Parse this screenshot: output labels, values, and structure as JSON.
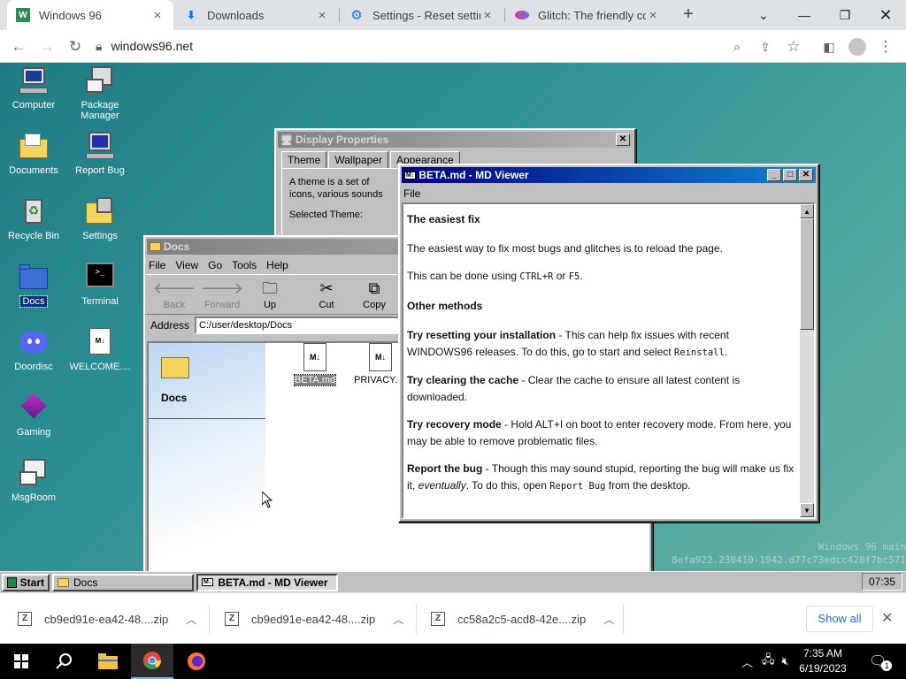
{
  "browser": {
    "tabs": [
      {
        "title": "Windows 96",
        "active": true
      },
      {
        "title": "Downloads",
        "active": false
      },
      {
        "title": "Settings - Reset settings",
        "active": false
      },
      {
        "title": "Glitch: The friendly community",
        "active": false
      }
    ],
    "new_tab": "+",
    "url": "windows96.net"
  },
  "desktop": {
    "icons": [
      {
        "label": "Computer",
        "icon": "computer-icon"
      },
      {
        "label": "Package Manager",
        "icon": "package-icon"
      },
      {
        "label": "Documents",
        "icon": "folder-icon"
      },
      {
        "label": "Report Bug",
        "icon": "bug-report-icon"
      },
      {
        "label": "Recycle Bin",
        "icon": "recycle-bin-icon"
      },
      {
        "label": "Settings",
        "icon": "settings-icon"
      },
      {
        "label": "Docs",
        "icon": "folder-icon",
        "selected": true
      },
      {
        "label": "Terminal",
        "icon": "terminal-icon"
      },
      {
        "label": "Doordisc",
        "icon": "discord-icon"
      },
      {
        "label": "WELCOME....",
        "icon": "md-file-icon"
      },
      {
        "label": "Gaming",
        "icon": "gaming-icon"
      },
      {
        "label": "MsgRoom",
        "icon": "msgroom-icon"
      }
    ],
    "watermark_line1": "Windows 96 main",
    "watermark_line2": "8efa922.230410-1942.d77c73edcc428f7bc571"
  },
  "display_properties": {
    "title": "Display Properties",
    "tabs": [
      "Theme",
      "Wallpaper",
      "Appearance"
    ],
    "description": "A theme is a set of icons, various sounds and other elements to help you personalize the user interface.",
    "selected_label": "Selected Theme:"
  },
  "docs_window": {
    "title": "Docs",
    "menu": [
      "File",
      "View",
      "Go",
      "Tools",
      "Help"
    ],
    "tools": [
      {
        "label": "Back",
        "icon": "back-arrow-icon",
        "enabled": false
      },
      {
        "label": "Forward",
        "icon": "forward-arrow-icon",
        "enabled": false
      },
      {
        "label": "Up",
        "icon": "up-folder-icon",
        "enabled": true
      },
      {
        "label": "Cut",
        "icon": "scissors-icon",
        "enabled": true
      },
      {
        "label": "Copy",
        "icon": "copy-icon",
        "enabled": true
      }
    ],
    "address_label": "Address",
    "address_value": "C:/user/desktop/Docs",
    "folder_heading": "Docs",
    "files": [
      {
        "name": "BETA.md",
        "selected": true
      },
      {
        "name": "PRIVACY.md",
        "selected": false
      }
    ]
  },
  "md_viewer": {
    "title": "BETA.md - MD Viewer",
    "menu": [
      "File"
    ],
    "heading1": "The easiest fix",
    "para1": "The easiest way to fix most bugs and glitches is to reload the page.",
    "para2_pre": "This can be done using ",
    "key1": "CTRL+R",
    "para2_mid": " or ",
    "key2": "F5",
    "para2_post": ".",
    "heading2": "Other methods",
    "item1_title": "Try resetting your installation",
    "item1_text": " - This can help fix issues with recent WINDOWS96 releases. To do this, go to start and select ",
    "item1_code": "Reinstall",
    "item1_end": ".",
    "item2_title": "Try clearing the cache",
    "item2_text": " - Clear the cache to ensure all latest content is downloaded.",
    "item3_title": "Try recovery mode",
    "item3_text": " - Hold ALT+I on boot to enter recovery mode. From here, you may be able to remove problematic files.",
    "item4_title": "Report the bug",
    "item4_text": " - Though this may sound stupid, reporting the bug will make us fix it, ",
    "item4_em": "eventually",
    "item4_text2": ". To do this, open ",
    "item4_code": "Report Bug",
    "item4_end": " from the desktop."
  },
  "w96_taskbar": {
    "start": "Start",
    "buttons": [
      {
        "label": "Docs",
        "active": false
      },
      {
        "label": "BETA.md - MD Viewer",
        "active": true
      }
    ],
    "clock": "07:35"
  },
  "downloads": {
    "items": [
      "cb9ed91e-ea42-48....zip",
      "cb9ed91e-ea42-48....zip",
      "cc58a2c5-acd8-42e....zip"
    ],
    "show_all": "Show all"
  },
  "os_taskbar": {
    "time": "7:35 AM",
    "date": "6/19/2023",
    "notifications": "1"
  }
}
